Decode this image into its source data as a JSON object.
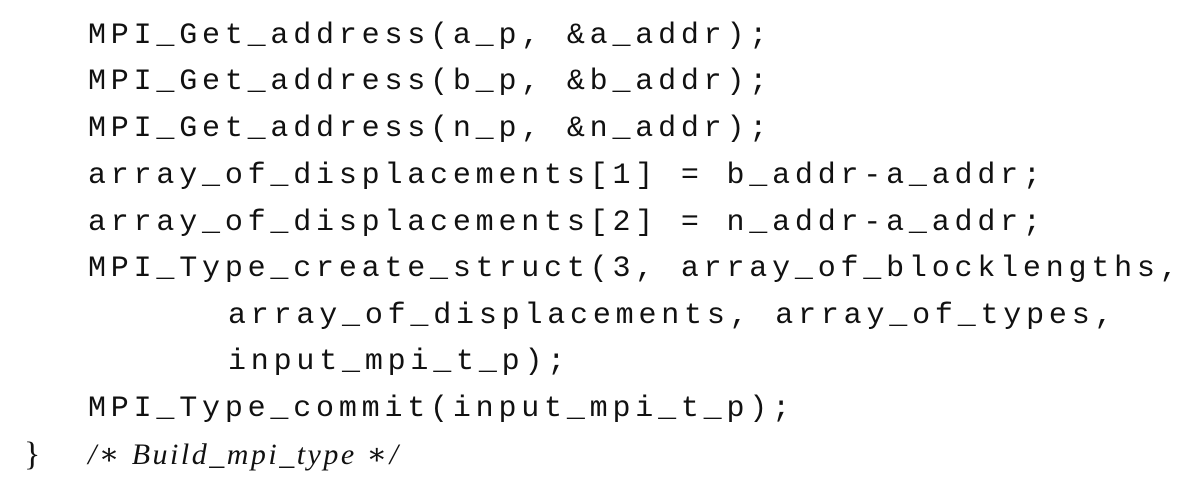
{
  "code": {
    "lines": [
      "MPI_Get_address(a_p, &a_addr);",
      "MPI_Get_address(b_p, &b_addr);",
      "MPI_Get_address(n_p, &n_addr);",
      "array_of_displacements[1] = b_addr-a_addr;",
      "array_of_displacements[2] = n_addr-a_addr;",
      "MPI_Type_create_struct(3, array_of_blocklengths,",
      "array_of_displacements, array_of_types,",
      "input_mpi_t_p);",
      "MPI_Type_commit(input_mpi_t_p);"
    ],
    "closing_brace": "}",
    "comment": "/∗ Build_mpi_type ∗/"
  }
}
